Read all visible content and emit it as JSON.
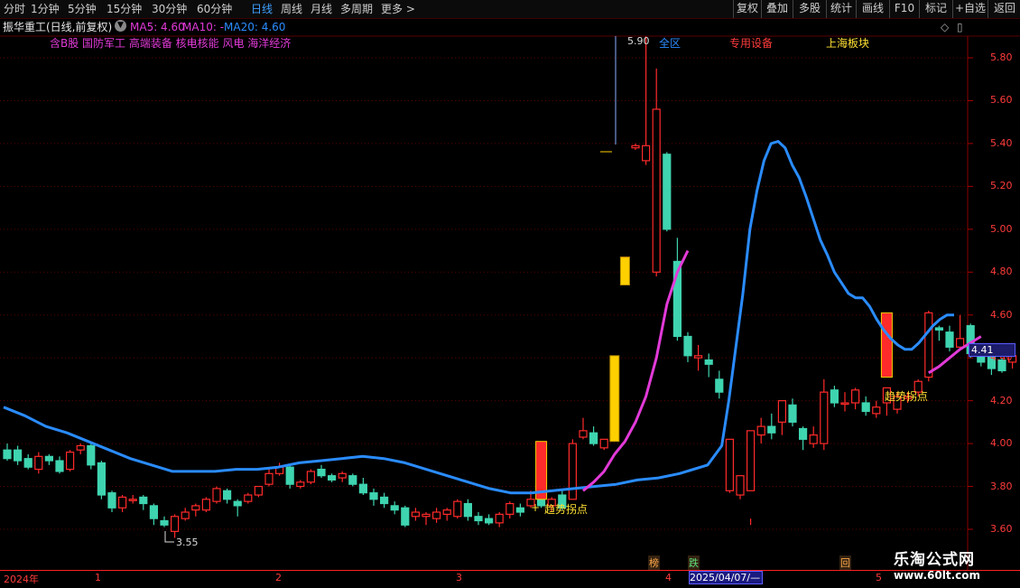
{
  "toolbar": {
    "periods": [
      "分时",
      "1分钟",
      "5分钟",
      "15分钟",
      "30分钟",
      "60分钟",
      "日线",
      "周线",
      "月线",
      "多周期",
      "更多"
    ],
    "active_period": "日线",
    "right_buttons": [
      "复权",
      "叠加",
      "多股",
      "统计",
      "画线",
      "F10",
      "标记",
      "+自选",
      "返回"
    ]
  },
  "title": {
    "stock": "振华重工(日线,前复权)",
    "ma5": "MA5: 4.60",
    "ma10": "MA10: -",
    "ma20": "MA20: 4.60"
  },
  "tags": {
    "concepts": "含B股 国防军工 高端装备 核电核能 风电 海洋经济",
    "region_note": "全区",
    "industry": "专用设备",
    "block": "上海板块"
  },
  "annotations": {
    "turn1": "趋势拐点",
    "turn2": "趋势拐点",
    "high": "5.90",
    "low": "3.55",
    "current_price": "4.41"
  },
  "xaxis": {
    "year": "2024年",
    "months": [
      "1",
      "2",
      "3",
      "4",
      "5"
    ],
    "date_box": "2025/04/07/—",
    "markers": [
      "榜",
      "跌",
      "回"
    ]
  },
  "watermark": {
    "line1": "乐淘公式网",
    "line2": "www.60lt.com"
  },
  "colors": {
    "up": "#ff2a2a",
    "down": "#3fd4b0",
    "ma_blue": "#2a8cff",
    "ma_magenta": "#e23ad8",
    "signal_yellow": "#ffd000"
  },
  "chart_data": {
    "type": "candlestick",
    "ylim": [
      3.52,
      5.92
    ],
    "yticks": [
      "5.80",
      "5.60",
      "5.40",
      "5.20",
      "5.00",
      "4.80",
      "4.60",
      "4.40",
      "4.20",
      "4.00",
      "3.80",
      "3.60"
    ],
    "candles": [
      [
        3.97,
        4.0,
        3.93,
        3.92
      ],
      [
        3.97,
        3.99,
        3.92,
        3.9
      ],
      [
        3.93,
        3.95,
        3.89,
        3.88
      ],
      [
        3.88,
        3.96,
        3.94,
        3.86
      ],
      [
        3.94,
        3.95,
        3.92,
        3.9
      ],
      [
        3.92,
        3.94,
        3.87,
        3.86
      ],
      [
        3.88,
        3.97,
        3.96,
        3.87
      ],
      [
        3.97,
        4.0,
        3.99,
        3.95
      ],
      [
        3.99,
        4.0,
        3.9,
        3.88
      ],
      [
        3.91,
        3.92,
        3.76,
        3.74
      ],
      [
        3.77,
        3.78,
        3.7,
        3.68
      ],
      [
        3.7,
        3.76,
        3.75,
        3.68
      ],
      [
        3.74,
        3.76,
        3.74,
        3.72
      ],
      [
        3.75,
        3.76,
        3.72,
        3.69
      ],
      [
        3.71,
        3.72,
        3.65,
        3.62
      ],
      [
        3.64,
        3.66,
        3.62,
        3.61
      ],
      [
        3.59,
        3.67,
        3.66,
        3.56
      ],
      [
        3.65,
        3.7,
        3.68,
        3.64
      ],
      [
        3.69,
        3.72,
        3.71,
        3.66
      ],
      [
        3.69,
        3.75,
        3.74,
        3.68
      ],
      [
        3.73,
        3.8,
        3.79,
        3.72
      ],
      [
        3.78,
        3.79,
        3.74,
        3.72
      ],
      [
        3.73,
        3.74,
        3.71,
        3.66
      ],
      [
        3.73,
        3.77,
        3.76,
        3.72
      ],
      [
        3.76,
        3.8,
        3.8,
        3.75
      ],
      [
        3.81,
        3.88,
        3.86,
        3.8
      ],
      [
        3.86,
        3.91,
        3.89,
        3.85
      ],
      [
        3.89,
        3.9,
        3.81,
        3.79
      ],
      [
        3.8,
        3.83,
        3.82,
        3.79
      ],
      [
        3.82,
        3.88,
        3.87,
        3.81
      ],
      [
        3.88,
        3.9,
        3.85,
        3.84
      ],
      [
        3.85,
        3.86,
        3.83,
        3.82
      ],
      [
        3.84,
        3.87,
        3.86,
        3.82
      ],
      [
        3.85,
        3.86,
        3.81,
        3.8
      ],
      [
        3.81,
        3.84,
        3.77,
        3.76
      ],
      [
        3.77,
        3.79,
        3.74,
        3.71
      ],
      [
        3.75,
        3.77,
        3.72,
        3.7
      ],
      [
        3.71,
        3.73,
        3.69,
        3.67
      ],
      [
        3.7,
        3.71,
        3.62,
        3.61
      ],
      [
        3.66,
        3.7,
        3.68,
        3.64
      ],
      [
        3.66,
        3.68,
        3.67,
        3.62
      ],
      [
        3.65,
        3.7,
        3.68,
        3.63
      ],
      [
        3.67,
        3.7,
        3.69,
        3.64
      ],
      [
        3.66,
        3.74,
        3.73,
        3.65
      ],
      [
        3.72,
        3.74,
        3.66,
        3.64
      ],
      [
        3.66,
        3.68,
        3.64,
        3.62
      ],
      [
        3.65,
        3.67,
        3.63,
        3.62
      ],
      [
        3.63,
        3.68,
        3.67,
        3.61
      ],
      [
        3.67,
        3.73,
        3.72,
        3.65
      ],
      [
        3.7,
        3.72,
        3.68,
        3.66
      ],
      [
        3.71,
        3.78,
        3.74,
        3.7
      ],
      [
        3.74,
        3.76,
        3.71,
        3.7
      ],
      [
        3.71,
        3.75,
        3.74,
        3.68
      ],
      [
        3.76,
        3.78,
        3.7,
        3.69
      ],
      [
        3.74,
        4.02,
        4.0,
        3.74
      ],
      [
        4.03,
        4.12,
        4.06,
        4.02
      ],
      [
        4.05,
        4.08,
        4.0,
        3.99
      ],
      [
        3.98,
        4.01,
        4.02,
        3.97
      ],
      [
        4.02,
        4.4,
        4.39,
        4.02
      ],
      [
        4.8,
        4.84,
        4.87,
        4.74
      ],
      [
        5.38,
        5.4,
        5.39,
        5.37
      ],
      [
        5.32,
        5.9,
        5.39,
        5.3
      ],
      [
        4.8,
        5.75,
        5.56,
        4.78
      ],
      [
        5.35,
        5.36,
        5.0,
        4.99
      ],
      [
        4.85,
        4.96,
        4.5,
        4.48
      ],
      [
        4.5,
        4.52,
        4.41,
        4.38
      ],
      [
        4.4,
        4.46,
        4.41,
        4.34
      ],
      [
        4.39,
        4.42,
        4.37,
        4.31
      ],
      [
        4.3,
        4.34,
        4.24,
        4.21
      ],
      [
        3.78,
        3.98,
        4.02,
        3.77
      ],
      [
        3.76,
        3.82,
        3.85,
        3.74
      ],
      [
        3.78,
        3.65,
        4.06,
        3.62
      ],
      [
        4.04,
        4.12,
        4.08,
        4.0
      ],
      [
        4.08,
        4.14,
        4.05,
        4.02
      ],
      [
        4.1,
        4.2,
        4.2,
        4.04
      ],
      [
        4.18,
        4.21,
        4.1,
        4.08
      ],
      [
        4.07,
        4.08,
        4.02,
        3.97
      ],
      [
        4.0,
        4.08,
        4.04,
        3.98
      ],
      [
        4.0,
        4.3,
        4.24,
        3.97
      ],
      [
        4.25,
        4.27,
        4.19,
        4.17
      ],
      [
        4.19,
        4.24,
        4.19,
        4.15
      ],
      [
        4.19,
        4.26,
        4.25,
        4.16
      ],
      [
        4.19,
        4.22,
        4.15,
        4.13
      ],
      [
        4.14,
        4.2,
        4.17,
        4.12
      ],
      [
        4.19,
        4.25,
        4.26,
        4.13
      ],
      [
        4.16,
        4.24,
        4.22,
        4.14
      ],
      [
        4.21,
        4.24,
        4.22,
        4.19
      ],
      [
        4.24,
        4.3,
        4.29,
        4.22
      ],
      [
        4.31,
        4.62,
        4.61,
        4.29
      ],
      [
        4.54,
        4.55,
        4.53,
        4.48
      ],
      [
        4.52,
        4.55,
        4.45,
        4.43
      ],
      [
        4.45,
        4.6,
        4.49,
        4.44
      ],
      [
        4.55,
        4.56,
        4.42,
        4.4
      ],
      [
        4.43,
        4.45,
        4.38,
        4.36
      ],
      [
        4.45,
        4.46,
        4.35,
        4.32
      ],
      [
        4.39,
        4.4,
        4.34,
        4.33
      ],
      [
        4.38,
        4.41,
        4.41,
        4.35
      ]
    ],
    "yellow_bars": [
      [
        58,
        4.01,
        4.41
      ],
      [
        59,
        4.74,
        4.87
      ]
    ],
    "ma_blue": [
      [
        0,
        4.17
      ],
      [
        6,
        4.13
      ],
      [
        12,
        4.08
      ],
      [
        18,
        4.05
      ],
      [
        24,
        4.01
      ],
      [
        30,
        3.97
      ],
      [
        36,
        3.93
      ],
      [
        42,
        3.9
      ],
      [
        48,
        3.87
      ],
      [
        54,
        3.87
      ],
      [
        60,
        3.87
      ],
      [
        66,
        3.88
      ],
      [
        72,
        3.88
      ],
      [
        78,
        3.89
      ],
      [
        84,
        3.91
      ],
      [
        90,
        3.92
      ],
      [
        96,
        3.93
      ],
      [
        102,
        3.94
      ],
      [
        108,
        3.93
      ],
      [
        114,
        3.91
      ],
      [
        120,
        3.88
      ],
      [
        126,
        3.85
      ],
      [
        132,
        3.82
      ],
      [
        138,
        3.79
      ],
      [
        144,
        3.77
      ],
      [
        150,
        3.77
      ],
      [
        156,
        3.78
      ],
      [
        162,
        3.79
      ],
      [
        168,
        3.8
      ],
      [
        174,
        3.81
      ],
      [
        180,
        3.83
      ],
      [
        186,
        3.84
      ],
      [
        192,
        3.86
      ],
      [
        200,
        3.9
      ],
      [
        204,
        3.99
      ],
      [
        206,
        4.2
      ],
      [
        210,
        4.7
      ],
      [
        212,
        5.0
      ],
      [
        214,
        5.18
      ],
      [
        216,
        5.32
      ],
      [
        218,
        5.4
      ],
      [
        220,
        5.41
      ],
      [
        222,
        5.38
      ],
      [
        224,
        5.3
      ],
      [
        226,
        5.24
      ],
      [
        228,
        5.15
      ],
      [
        230,
        5.05
      ],
      [
        232,
        4.95
      ],
      [
        234,
        4.88
      ],
      [
        236,
        4.8
      ],
      [
        238,
        4.75
      ],
      [
        240,
        4.7
      ],
      [
        242,
        4.68
      ],
      [
        244,
        4.68
      ],
      [
        246,
        4.64
      ],
      [
        248,
        4.58
      ],
      [
        250,
        4.53
      ],
      [
        252,
        4.49
      ],
      [
        254,
        4.46
      ],
      [
        256,
        4.44
      ],
      [
        258,
        4.44
      ],
      [
        260,
        4.47
      ],
      [
        262,
        4.51
      ],
      [
        264,
        4.55
      ],
      [
        266,
        4.58
      ],
      [
        268,
        4.6
      ],
      [
        270,
        4.6
      ]
    ],
    "ma_magenta": [
      [
        55,
        3.78
      ],
      [
        56,
        3.82
      ],
      [
        57,
        3.87
      ],
      [
        58,
        3.95
      ],
      [
        59,
        4.01
      ],
      [
        60,
        4.1
      ],
      [
        61,
        4.22
      ],
      [
        62,
        4.4
      ],
      [
        63,
        4.65
      ],
      [
        64,
        4.8
      ],
      [
        65,
        4.9
      ]
    ],
    "ma_magenta2": [
      [
        88,
        4.33
      ],
      [
        89,
        4.36
      ],
      [
        90,
        4.4
      ],
      [
        91,
        4.44
      ],
      [
        92,
        4.47
      ],
      [
        93,
        4.5
      ]
    ]
  }
}
